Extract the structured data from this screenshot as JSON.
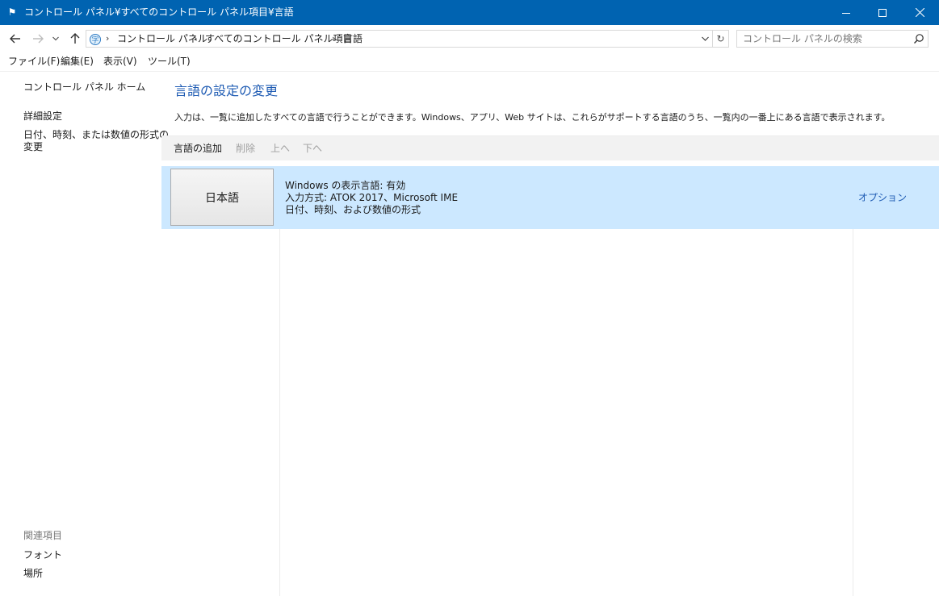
{
  "window": {
    "title": "コントロール パネル¥すべてのコントロール パネル項目¥言語",
    "title_bar_color": "#0063b1"
  },
  "address": {
    "crumbs": [
      "コントロール パネル",
      "すべてのコントロール パネル項目",
      "言語"
    ],
    "search_placeholder": "コントロール パネルの検索"
  },
  "menu": {
    "file": "ファイル(F)",
    "edit": "編集(E)",
    "view": "表示(V)",
    "tools": "ツール(T)"
  },
  "sidebar": {
    "home": "コントロール パネル ホーム",
    "advanced": "詳細設定",
    "datetime_line1": "日付、時刻、または数値の形式の",
    "datetime_line2": "変更",
    "related_heading": "関連項目",
    "fonts": "フォント",
    "location": "場所"
  },
  "main": {
    "heading": "言語の設定の変更",
    "description": "入力は、一覧に追加したすべての言語で行うことができます。Windows、アプリ、Web サイトは、これらがサポートする言語のうち、一覧内の一番上にある言語で表示されます。",
    "toolbar": {
      "add": "言語の追加",
      "remove": "削除",
      "up": "上へ",
      "down": "下へ"
    },
    "languages": [
      {
        "name": "日本語",
        "display_language": "Windows の表示言語: 有効",
        "input_method": "入力方式: ATOK 2017、Microsoft IME",
        "formats": "日付、時刻、および数値の形式",
        "options": "オプション"
      }
    ],
    "selected_row_color": "#cce8ff",
    "link_color": "#1e5bb3"
  }
}
